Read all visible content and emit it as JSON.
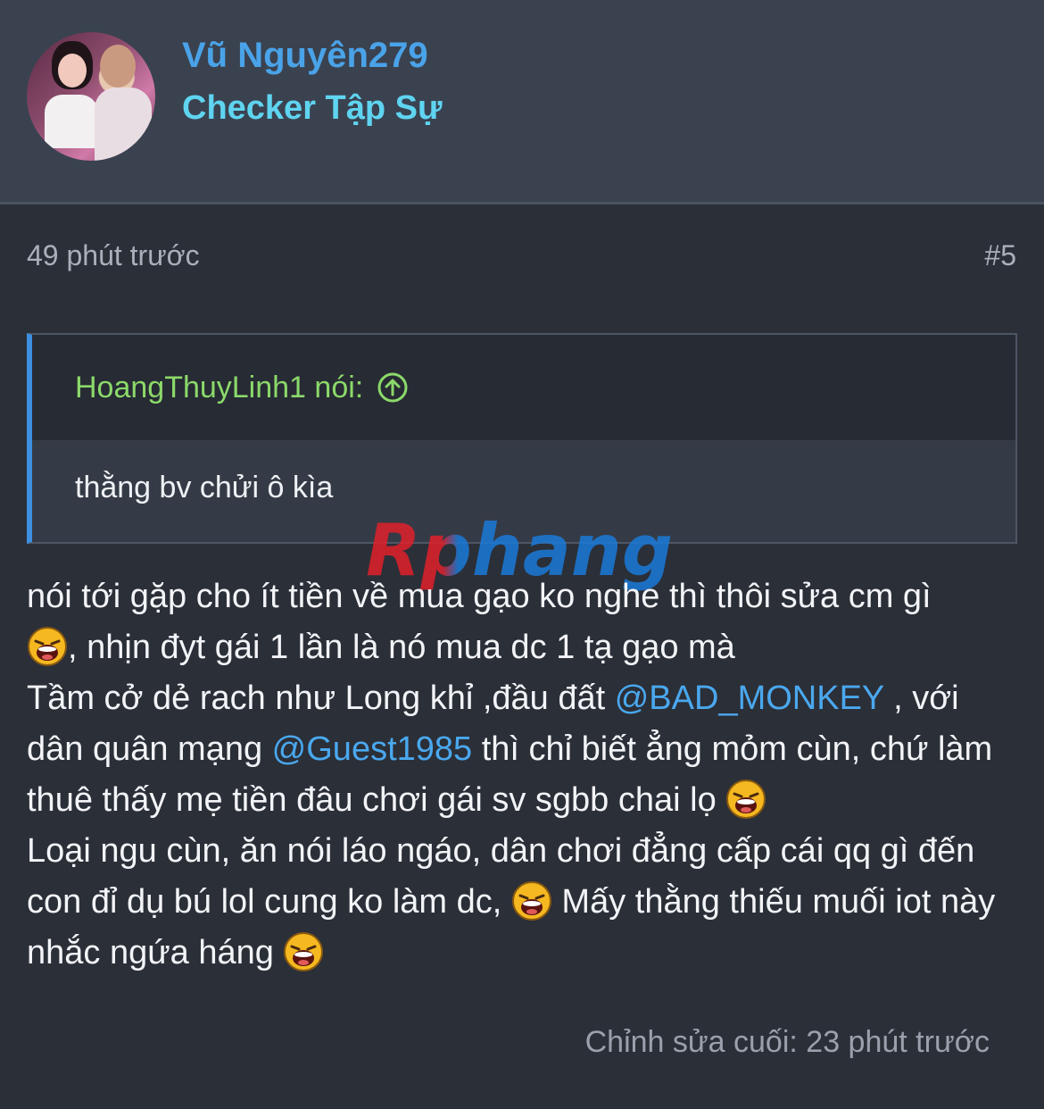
{
  "author": {
    "name": "Vũ Nguyên279",
    "title": "Checker Tập Sự"
  },
  "post": {
    "time": "49 phút trước",
    "number": "#5",
    "edited": "Chỉnh sửa cuối: 23 phút trước"
  },
  "quote": {
    "author": "HoangThuyLinh1 nói:",
    "text": "thằng bv chửi ô kìa"
  },
  "watermark": "Rphang",
  "body": {
    "p1a": "nói tới gặp cho ít tiền về mua gạo ko nghe thì thôi sửa cm gì",
    "p1b": ", nhịn đyt gái 1 lần là nó mua dc 1 tạ gạo mà",
    "p2a": "Tầm cở dẻ rach như Long khỉ ,đầu đất ",
    "mention1": "@BAD_MONKEY",
    "p2b": " , với dân quân mạng ",
    "mention2": "@Guest1985",
    "p2c": " thì chỉ biết ẳng mỏm cùn, chứ làm thuê thấy mẹ tiền đâu chơi gái sv sgbb chai lọ ",
    "p3a": "Loại ngu cùn, ăn nói láo ngáo, dân chơi đẳng cấp cái qq gì đến con đỉ dụ bú lol cung ko làm dc, ",
    "p3b": " Mấy thằng thiếu muối iot này nhắc ngứa háng "
  },
  "icons": {
    "quote_jump": "arrow-up-circle-icon",
    "emoji": "laughing-emoji-icon"
  },
  "colors": {
    "background": "#2b2f38",
    "header": "#3a4250",
    "username": "#4aa3e8",
    "usertitle": "#5fd4f0",
    "quote_author": "#8bd96a",
    "mention": "#4aa8ee",
    "quote_bar": "#3d8fe0"
  }
}
